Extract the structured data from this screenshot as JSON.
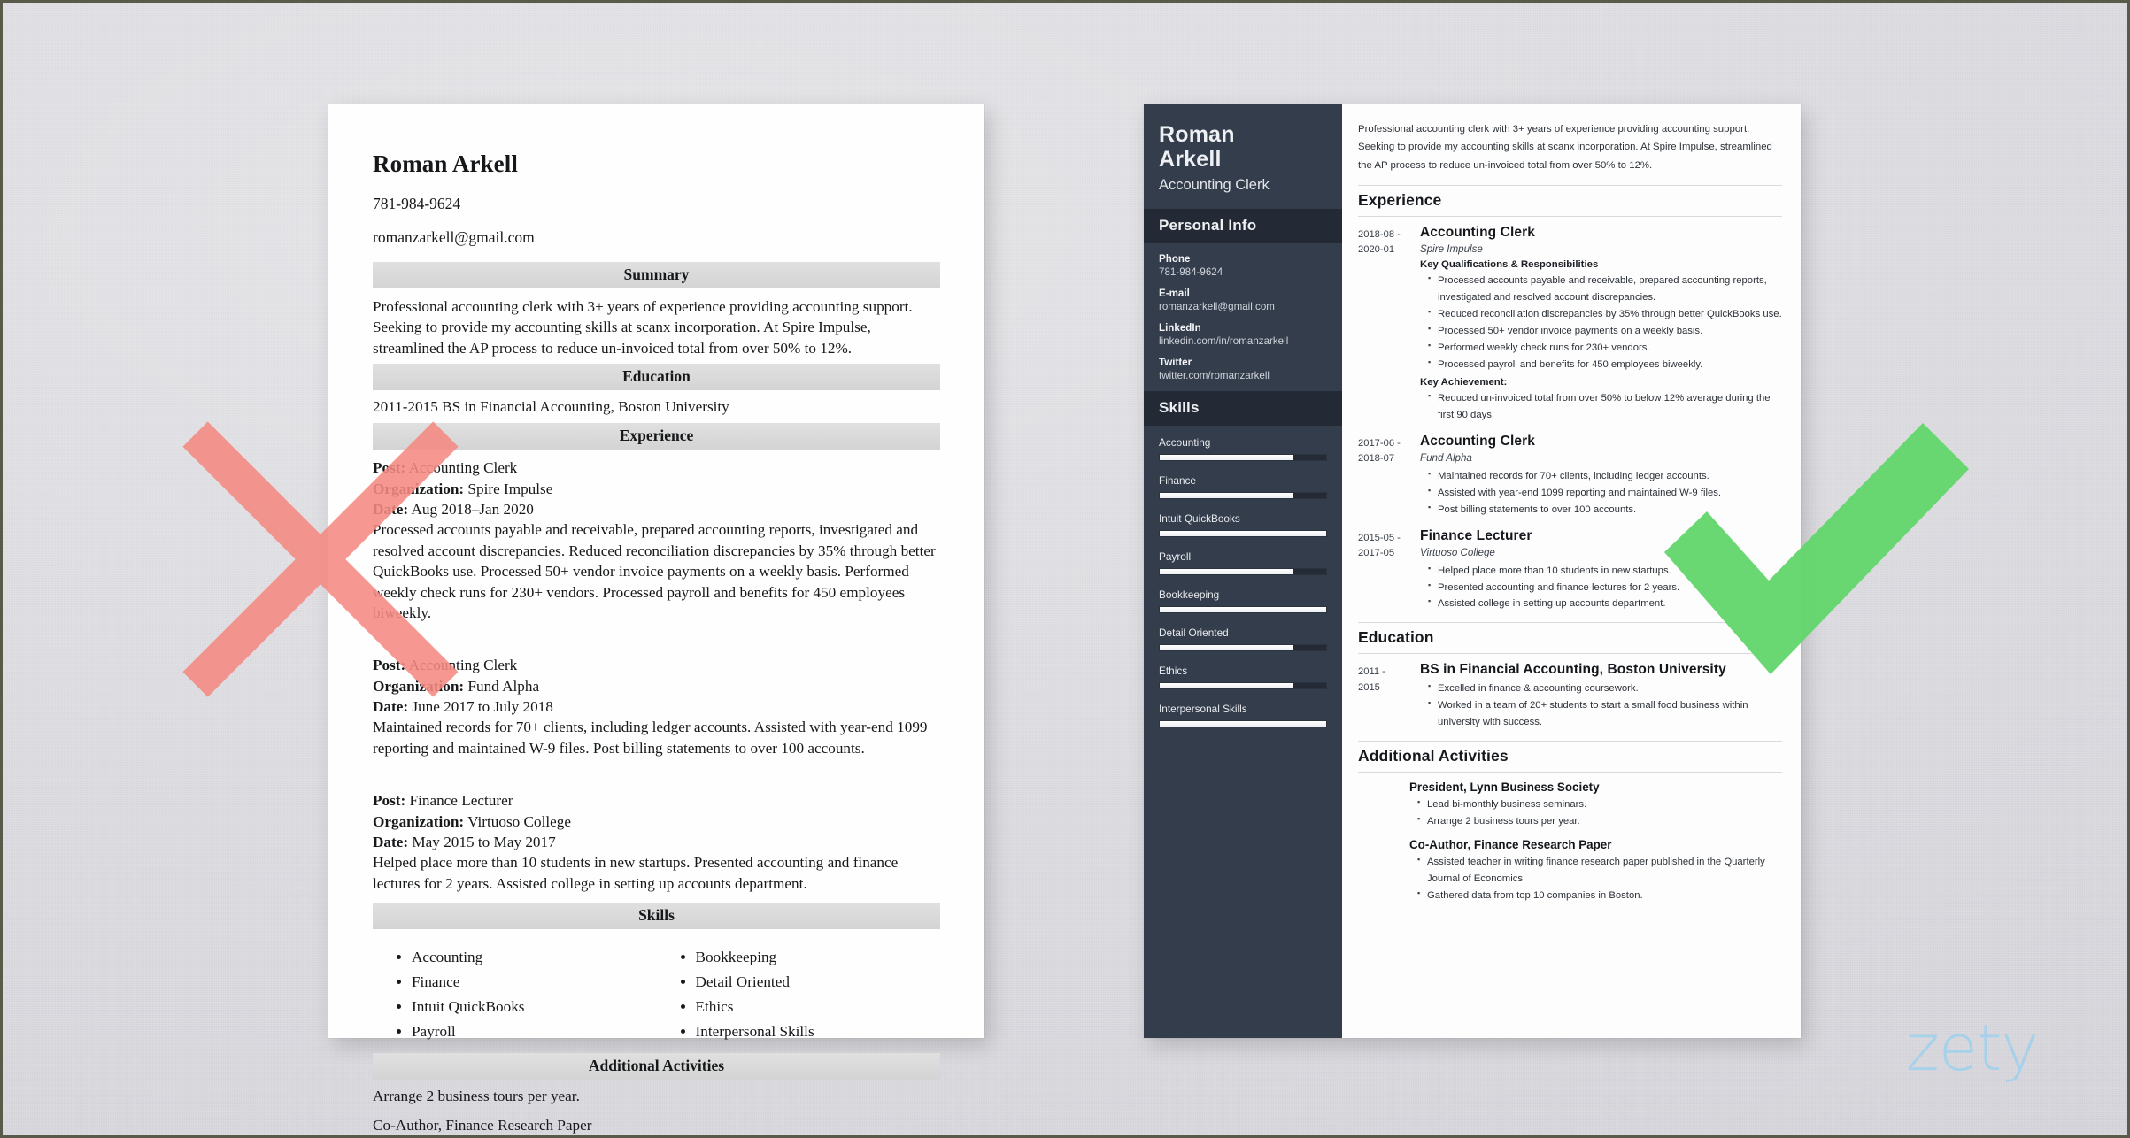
{
  "colors": {
    "backdrop": "#dddde1",
    "mark_x": "#f58a82",
    "mark_check": "#62d66a",
    "sidebar_dark": "#343d4c",
    "sidebar_header_dark": "#232a36",
    "section_bar_gray": "#dadada",
    "logo_blue": "#a6d1ea"
  },
  "watermark": {
    "label": "zety"
  },
  "marks": {
    "reject": {
      "icon": "x-mark-icon",
      "meaning": "Bad resume example"
    },
    "accept": {
      "icon": "check-mark-icon",
      "meaning": "Good resume example"
    }
  },
  "resume_bad": {
    "name": "Roman Arkell",
    "phone": "781-984-9624",
    "email": "romanzarkell@gmail.com",
    "sections": {
      "summary_heading": "Summary",
      "summary_text": "Professional accounting clerk with 3+ years of experience providing accounting support. Seeking to provide my accounting skills at scanx incorporation. At Spire Impulse, streamlined the AP process to reduce un-invoiced total from over 50% to 12%.",
      "education_heading": "Education",
      "education_line": "2011-2015  BS in Financial Accounting, Boston University",
      "experience_heading": "Experience",
      "skills_heading": "Skills",
      "activities_heading": "Additional Activities"
    },
    "labels": {
      "post": "Post:",
      "organization": "Organization:",
      "date": "Date:"
    },
    "jobs": [
      {
        "post": "Accounting Clerk",
        "organization": "Spire Impulse",
        "date": "Aug 2018–Jan 2020",
        "description": "Processed accounts payable and receivable, prepared accounting reports, investigated and resolved account discrepancies. Reduced reconciliation discrepancies by 35% through better QuickBooks use. Processed 50+ vendor invoice payments on a weekly basis. Performed weekly check runs for 230+ vendors. Processed payroll and benefits for 450 employees biweekly."
      },
      {
        "post": "Accounting Clerk",
        "organization": "Fund Alpha",
        "date": "June 2017 to July 2018",
        "description": "Maintained records for 70+ clients, including ledger accounts. Assisted with year-end 1099 reporting and maintained W-9 files. Post billing statements to over 100 accounts."
      },
      {
        "post": "Finance Lecturer",
        "organization": "Virtuoso College",
        "date": "May 2015 to May 2017",
        "description": "Helped place more than 10 students in new startups. Presented accounting and finance lectures for 2 years. Assisted college in setting up accounts department."
      }
    ],
    "skills_left": [
      "Accounting",
      "Finance",
      "Intuit QuickBooks",
      "Payroll"
    ],
    "skills_right": [
      "Bookkeeping",
      "Detail Oriented",
      "Ethics",
      "Interpersonal Skills"
    ],
    "activities": [
      "Arrange 2 business tours per year.",
      "Co-Author, Finance Research Paper"
    ]
  },
  "resume_good": {
    "name_line1": "Roman",
    "name_line2": "Arkell",
    "job_title": "Accounting Clerk",
    "personal_info_heading": "Personal Info",
    "contacts": [
      {
        "label": "Phone",
        "value": "781-984-9624"
      },
      {
        "label": "E-mail",
        "value": "romanzarkell@gmail.com"
      },
      {
        "label": "LinkedIn",
        "value": "linkedin.com/in/romanzarkell"
      },
      {
        "label": "Twitter",
        "value": "twitter.com/romanzarkell"
      }
    ],
    "skills_heading": "Skills",
    "skills": [
      {
        "name": "Accounting",
        "level": 80
      },
      {
        "name": "Finance",
        "level": 80
      },
      {
        "name": "Intuit QuickBooks",
        "level": 100
      },
      {
        "name": "Payroll",
        "level": 80
      },
      {
        "name": "Bookkeeping",
        "level": 100
      },
      {
        "name": "Detail Oriented",
        "level": 80
      },
      {
        "name": "Ethics",
        "level": 80
      },
      {
        "name": "Interpersonal Skills",
        "level": 100
      }
    ],
    "summary": "Professional accounting clerk with 3+ years of experience providing accounting support. Seeking to provide my accounting skills at scanx incorporation. At Spire Impulse, streamlined the AP process to reduce un-invoiced total from over 50% to 12%.",
    "experience_heading": "Experience",
    "experience": [
      {
        "date_from": "2018-08 -",
        "date_to": "2020-01",
        "title": "Accounting Clerk",
        "org": "Spire Impulse",
        "sub_heading": "Key Qualifications & Responsibilities",
        "bullets": [
          "Processed accounts payable and receivable, prepared accounting reports, investigated and resolved account discrepancies.",
          "Reduced reconciliation discrepancies by 35% through better QuickBooks use.",
          "Processed 50+ vendor invoice payments on a weekly basis.",
          "Performed weekly check runs for 230+ vendors.",
          "Processed payroll and benefits for 450 employees biweekly."
        ],
        "sub_heading_2": "Key Achievement:",
        "bullets_2": [
          "Reduced un-invoiced total from over 50% to below 12% average during the first 90 days."
        ]
      },
      {
        "date_from": "2017-06 -",
        "date_to": "2018-07",
        "title": "Accounting Clerk",
        "org": "Fund Alpha",
        "bullets": [
          "Maintained records for 70+ clients, including ledger accounts.",
          "Assisted with year-end 1099 reporting and maintained W-9 files.",
          "Post billing statements to over 100 accounts."
        ]
      },
      {
        "date_from": "2015-05 -",
        "date_to": "2017-05",
        "title": "Finance Lecturer",
        "org": "Virtuoso College",
        "bullets": [
          "Helped place more than 10 students in new startups.",
          "Presented accounting and finance lectures for 2 years.",
          "Assisted college in setting up accounts department."
        ]
      }
    ],
    "education_heading": "Education",
    "education": [
      {
        "date_from": "2011 -",
        "date_to": "2015",
        "title": "BS in Financial Accounting, Boston University",
        "bullets": [
          "Excelled in finance & accounting coursework.",
          "Worked in a team of 20+ students to start a small food business within university with success."
        ]
      }
    ],
    "activities_heading": "Additional Activities",
    "activities": [
      {
        "title": "President, Lynn Business Society",
        "bullets": [
          "Lead bi-monthly business seminars.",
          "Arrange 2 business tours per year."
        ]
      },
      {
        "title": "Co-Author, Finance Research Paper",
        "bullets": [
          "Assisted teacher in writing finance research paper published in the Quarterly Journal of Economics",
          "Gathered data from top 10 companies in Boston."
        ]
      }
    ]
  }
}
